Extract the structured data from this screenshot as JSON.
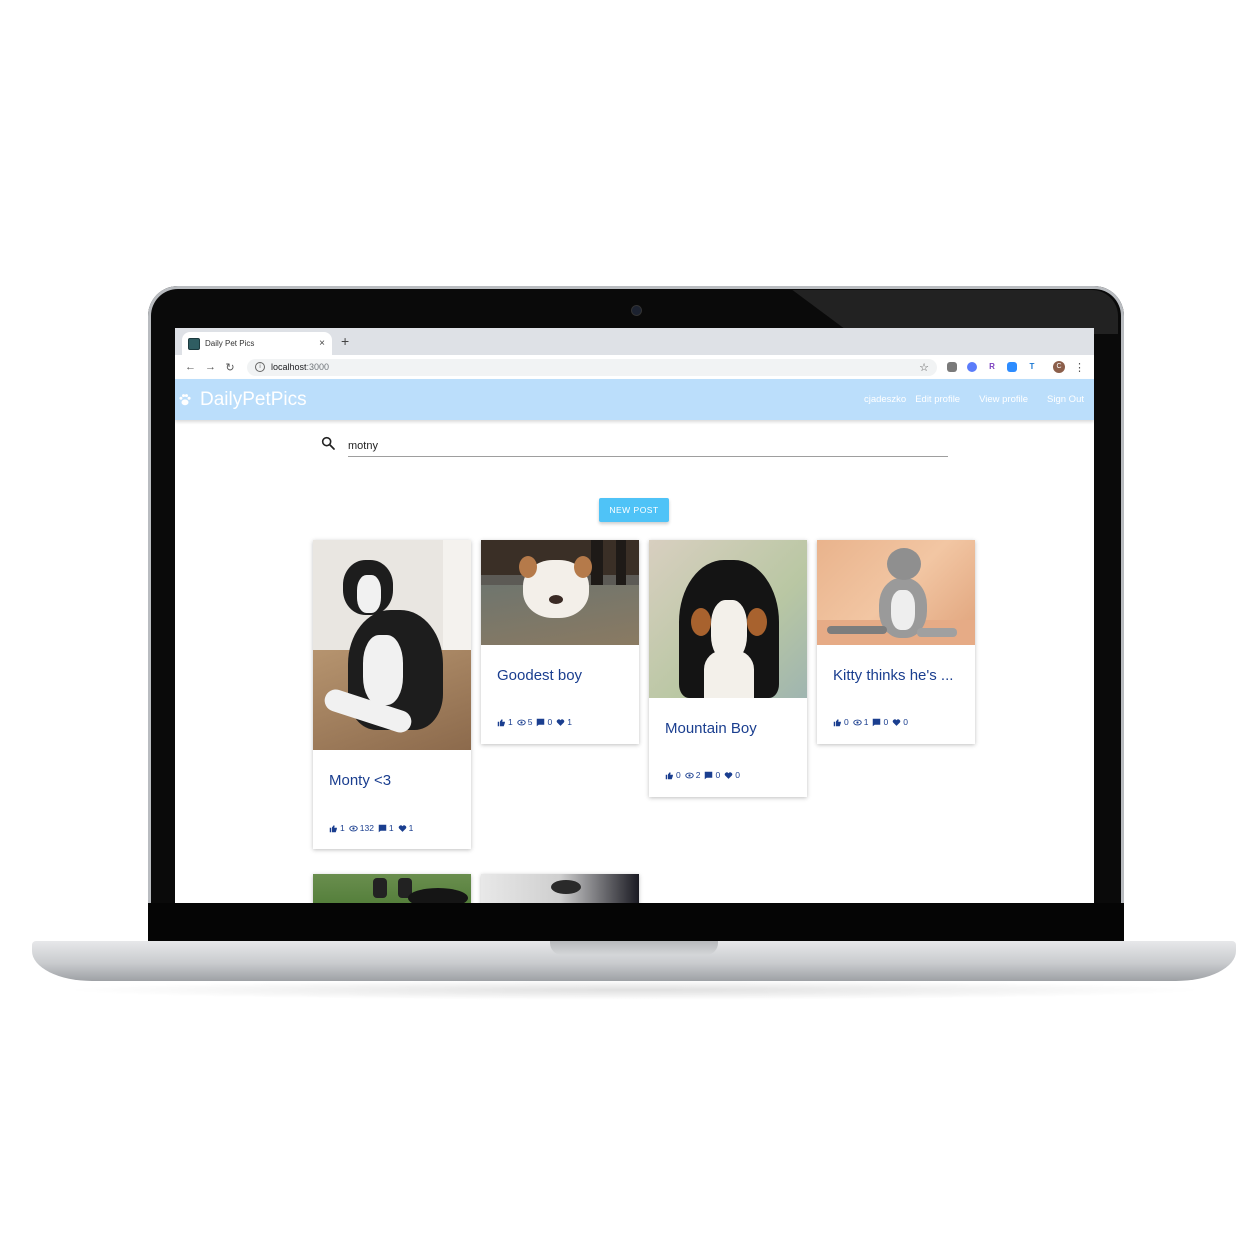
{
  "browser": {
    "tab_title": "Daily Pet Pics",
    "tab_close": "×",
    "new_tab": "+",
    "url_host": "localhost",
    "url_port": ":3000",
    "profile_initial": "C"
  },
  "app": {
    "brand": "DailyPetPics",
    "nav": {
      "username": "cjadeszko",
      "edit_profile": "Edit profile",
      "view_profile": "View profile",
      "sign_out": "Sign Out"
    },
    "search": {
      "value": "motny"
    },
    "new_post_label": "NEW POST"
  },
  "posts": [
    {
      "title": "Monty <3",
      "likes": "1",
      "views": "132",
      "comments": "1",
      "hearts": "1"
    },
    {
      "title": "Goodest boy",
      "likes": "1",
      "views": "5",
      "comments": "0",
      "hearts": "1"
    },
    {
      "title": "Mountain Boy",
      "likes": "0",
      "views": "2",
      "comments": "0",
      "hearts": "0"
    },
    {
      "title": "Kitty thinks he's ...",
      "likes": "0",
      "views": "1",
      "comments": "0",
      "hearts": "0"
    }
  ],
  "icons": {
    "paw": "paw-icon",
    "search": "search-icon",
    "like": "thumb-up-icon",
    "view": "eye-icon",
    "comment": "comment-icon",
    "heart": "heart-icon"
  },
  "colors": {
    "appbar": "#bbdefb",
    "button": "#4fc3f7",
    "card_text": "#1a3e8f"
  }
}
